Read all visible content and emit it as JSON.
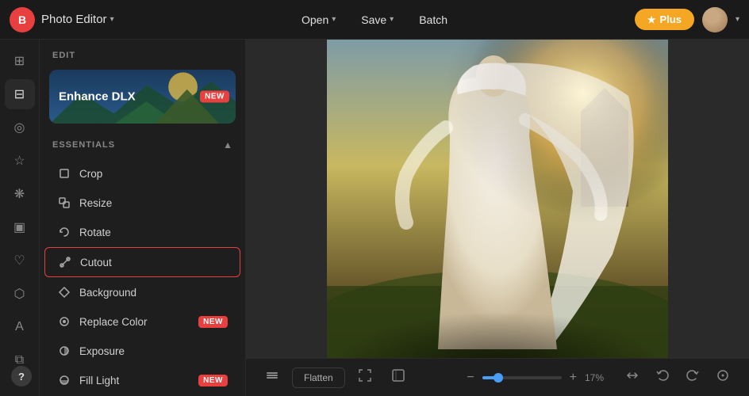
{
  "app": {
    "logo_text": "B",
    "title": "Photo Editor",
    "title_chevron": "▾"
  },
  "topbar": {
    "open_label": "Open",
    "save_label": "Save",
    "batch_label": "Batch",
    "plus_label": "Plus",
    "star_icon": "★",
    "avatar_chevron": "▾"
  },
  "icon_sidebar": {
    "icons": [
      {
        "name": "home-icon",
        "glyph": "⊞",
        "active": false
      },
      {
        "name": "adjust-icon",
        "glyph": "⊟",
        "active": true
      },
      {
        "name": "eye-icon",
        "glyph": "◎",
        "active": false
      },
      {
        "name": "star-icon",
        "glyph": "☆",
        "active": false
      },
      {
        "name": "nodes-icon",
        "glyph": "❋",
        "active": false
      },
      {
        "name": "frame-icon",
        "glyph": "▣",
        "active": false
      },
      {
        "name": "heart-icon",
        "glyph": "♡",
        "active": false
      },
      {
        "name": "shape-icon",
        "glyph": "⬡",
        "active": false
      },
      {
        "name": "text-icon",
        "glyph": "A",
        "active": false
      },
      {
        "name": "texture-icon",
        "glyph": "⧉",
        "active": false
      }
    ],
    "help_label": "?"
  },
  "edit_panel": {
    "edit_label": "EDIT",
    "enhance_card": {
      "label": "Enhance DLX",
      "badge": "NEW"
    },
    "essentials_label": "ESSENTIALS",
    "essentials_chevron": "▲",
    "menu_items": [
      {
        "id": "crop",
        "label": "Crop",
        "icon": "⊡",
        "badge": null,
        "active": false
      },
      {
        "id": "resize",
        "label": "Resize",
        "icon": "⤡",
        "badge": null,
        "active": false
      },
      {
        "id": "rotate",
        "label": "Rotate",
        "icon": "↺",
        "badge": null,
        "active": false
      },
      {
        "id": "cutout",
        "label": "Cutout",
        "icon": "✂",
        "badge": null,
        "active": true
      },
      {
        "id": "background",
        "label": "Background",
        "icon": "◈",
        "badge": null,
        "active": false
      },
      {
        "id": "replace-color",
        "label": "Replace Color",
        "icon": "◉",
        "badge": "NEW",
        "active": false
      },
      {
        "id": "exposure",
        "label": "Exposure",
        "icon": "◐",
        "badge": null,
        "active": false
      },
      {
        "id": "fill-light",
        "label": "Fill Light",
        "icon": "◑",
        "badge": "NEW",
        "active": false
      }
    ]
  },
  "bottom_toolbar": {
    "layers_icon": "⧉",
    "flatten_label": "Flatten",
    "expand_icon": "⤢",
    "fullscreen_icon": "⤡",
    "zoom_minus": "−",
    "zoom_plus": "+",
    "zoom_value": "17%",
    "zoom_percent": 17,
    "flip_icon": "⇄",
    "undo_icon": "↩",
    "redo_icon": "↪",
    "history_icon": "⊙"
  },
  "colors": {
    "accent_red": "#e83f3f",
    "accent_orange": "#f5a623",
    "accent_blue": "#4a9ef5",
    "bg_dark": "#1a1a1a",
    "bg_panel": "#1e1e1e",
    "active_border": "#e83f3f"
  }
}
